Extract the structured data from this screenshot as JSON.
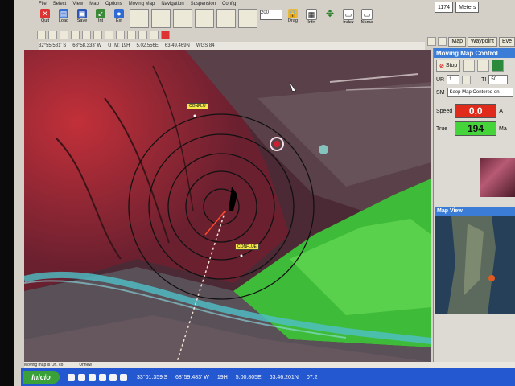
{
  "menu": {
    "items": [
      "File",
      "Select",
      "View",
      "Map",
      "Options",
      "Moving Map",
      "Navigation",
      "Suspension",
      "Config"
    ]
  },
  "toolbar": {
    "buttons": [
      {
        "label": "Quit",
        "icon": "quit-icon"
      },
      {
        "label": "Load",
        "icon": "load-icon"
      },
      {
        "label": "Save",
        "icon": "save-icon"
      },
      {
        "label": "Int",
        "icon": "int-icon"
      },
      {
        "label": "Ext",
        "icon": "ext-icon"
      },
      {
        "label": "Drag",
        "icon": "drag-icon"
      },
      {
        "label": "Info",
        "icon": "info-icon"
      },
      {
        "label": "Index",
        "icon": "index-icon"
      },
      {
        "label": "Name",
        "icon": "name-icon"
      }
    ],
    "zoom_value": "200"
  },
  "altitude": {
    "value": "1174",
    "unit": "Meters"
  },
  "coords_top": {
    "lat": "32°55.581' S",
    "lon": "68°58.333' W",
    "utm": "UTM: 19H",
    "east": "5.02.556E",
    "north": "63.49.469N",
    "datum": "WGS 84"
  },
  "tabs": [
    "Map",
    "Waypoint",
    "Eve"
  ],
  "map": {
    "labels": [
      "CONFLU",
      "CONFLUE"
    ]
  },
  "panel": {
    "title": "Moving Map Control",
    "stop_label": "Stop",
    "ur_label": "UR",
    "ur_value": "1",
    "ti_label": "TI",
    "ti_value": "50",
    "sm_label": "SM",
    "sm_value": "Keep Map Centered on",
    "speed_label": "Speed",
    "speed_value": "0,0",
    "true_label": "True",
    "true_value": "194",
    "a_label": "A",
    "ma_label": "Ma",
    "map_view_title": "Map View",
    "colors": {
      "speed_bg": "#e02a1c",
      "true_bg": "#45d43a",
      "title_bg": "#3b7cd6"
    }
  },
  "status": {
    "left": "Moving map is On. co",
    "mid": "Unnew"
  },
  "taskbar": {
    "start_label": "Inicio",
    "coords": [
      "33°01.359'S",
      "68°59.483' W",
      "19H",
      "5.00.805E",
      "63.46.201N"
    ],
    "time": "07:2"
  }
}
